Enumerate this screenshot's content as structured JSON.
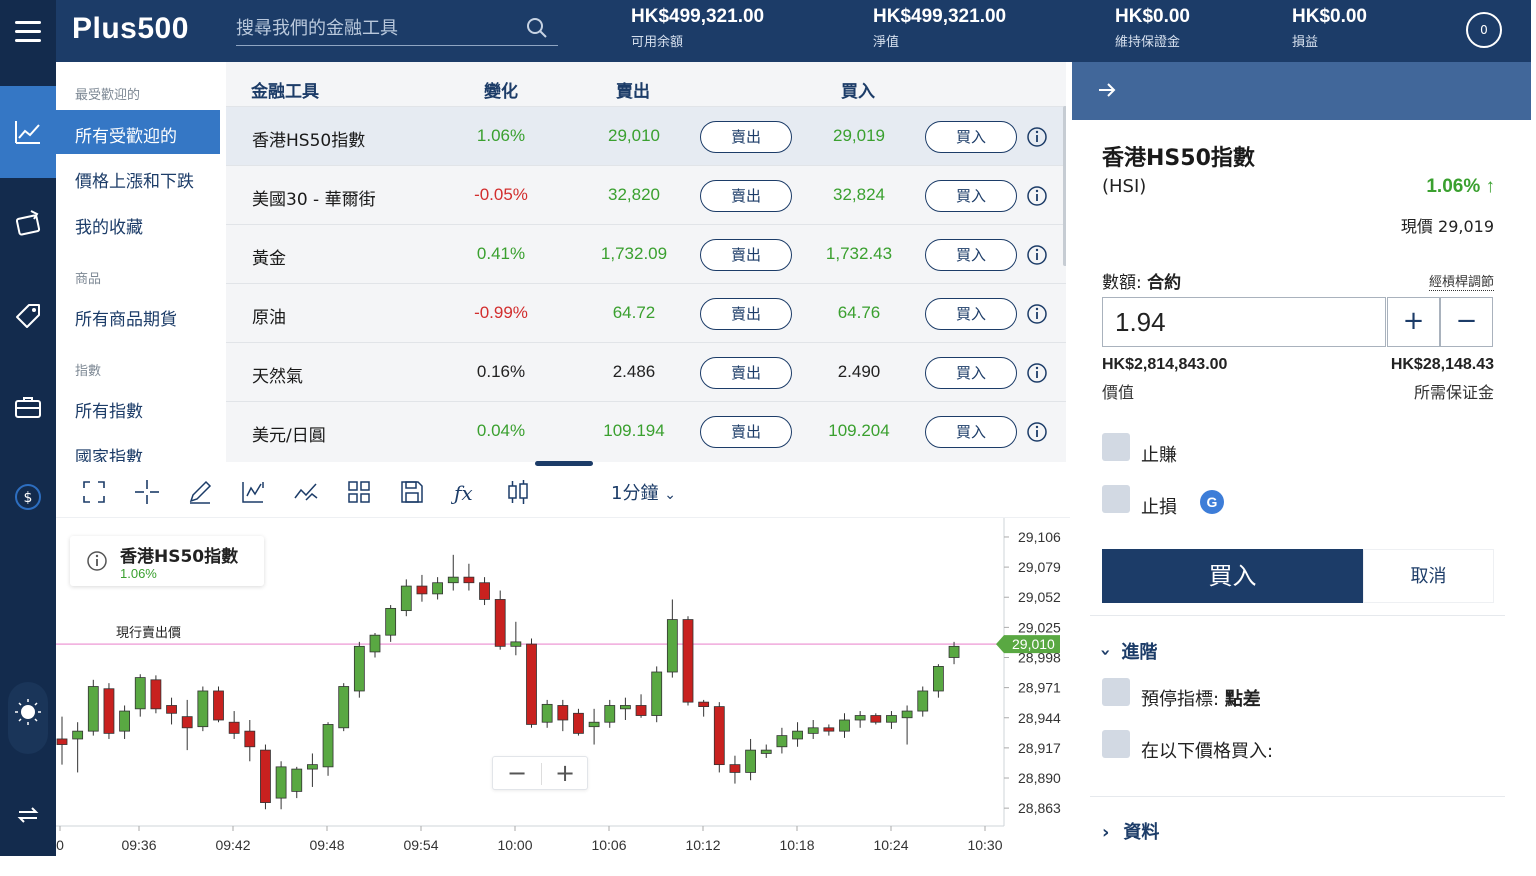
{
  "header": {
    "logo": "Plus500",
    "search_placeholder": "搜尋我們的金融工具",
    "stats": [
      {
        "value": "HK$499,321.00",
        "label": "可用余額"
      },
      {
        "value": "HK$499,321.00",
        "label": "淨值"
      },
      {
        "value": "HK$0.00",
        "label": "維持保證金"
      },
      {
        "value": "HK$0.00",
        "label": "損益"
      }
    ],
    "notifications": "0"
  },
  "categories": {
    "sections": [
      {
        "title": "最受歡迎的",
        "items": [
          "所有受歡迎的",
          "價格上漲和下跌",
          "我的收藏"
        ]
      },
      {
        "title": "商品",
        "items": [
          "所有商品期貨"
        ]
      },
      {
        "title": "指數",
        "items": [
          "所有指數",
          "國家指數"
        ]
      }
    ],
    "active": "所有受歡迎的"
  },
  "table": {
    "headers": {
      "instrument": "金融工具",
      "change": "變化",
      "sell": "賣出",
      "buy": "買入"
    },
    "sell_btn": "賣出",
    "buy_btn": "買入",
    "rows": [
      {
        "name": "香港HS50指數",
        "change": "1.06%",
        "dir": "pos",
        "sell": "29,010",
        "buy": "29,019"
      },
      {
        "name": "美國30 - 華爾街",
        "change": "-0.05%",
        "dir": "neg",
        "sell": "32,820",
        "buy": "32,824"
      },
      {
        "name": "黃金",
        "change": "0.41%",
        "dir": "pos",
        "sell": "1,732.09",
        "buy": "1,732.43"
      },
      {
        "name": "原油",
        "change": "-0.99%",
        "dir": "neg",
        "sell": "64.72",
        "buy": "64.76"
      },
      {
        "name": "天然氣",
        "change": "0.16%",
        "dir": "neu",
        "sell": "2.486",
        "buy": "2.490"
      },
      {
        "name": "美元/日圓",
        "change": "0.04%",
        "dir": "pos",
        "sell": "109.194",
        "buy": "109.204"
      }
    ]
  },
  "chart_toolbar": {
    "icons": [
      "fullscreen-icon",
      "crosshair-icon",
      "draw-icon",
      "chart-type-icon",
      "indicator-icon",
      "layout-icon",
      "save-icon",
      "function-icon",
      "candle-icon"
    ],
    "timeframe": "1分鐘"
  },
  "chart_legend": {
    "title": "香港HS50指數",
    "change": "1.06%"
  },
  "current_sell_label": "現行賣出價",
  "chart_data": {
    "type": "candlestick",
    "y_ticks": [
      "29,106",
      "29,079",
      "29,052",
      "29,025",
      "28,998",
      "28,971",
      "28,944",
      "28,917",
      "28,890",
      "28,863"
    ],
    "x_ticks": [
      "0",
      "09:36",
      "09:42",
      "09:48",
      "09:54",
      "10:00",
      "10:06",
      "10:12",
      "10:18",
      "10:24",
      "10:30"
    ],
    "current_price": 29010,
    "current_price_label": "29,010",
    "ylim": [
      28847,
      29123
    ],
    "candles": [
      [
        28925,
        28945,
        28902,
        28920
      ],
      [
        28925,
        28940,
        28895,
        28932
      ],
      [
        28932,
        28978,
        28928,
        28972
      ],
      [
        28970,
        28975,
        28925,
        28930
      ],
      [
        28932,
        28955,
        28925,
        28950
      ],
      [
        28952,
        28983,
        28945,
        28980
      ],
      [
        28978,
        28982,
        28948,
        28952
      ],
      [
        28955,
        28962,
        28938,
        28948
      ],
      [
        28945,
        28960,
        28915,
        28935
      ],
      [
        28936,
        28972,
        28932,
        28968
      ],
      [
        28968,
        28972,
        28940,
        28942
      ],
      [
        28940,
        28950,
        28925,
        28930
      ],
      [
        28932,
        28942,
        28905,
        28918
      ],
      [
        28915,
        28920,
        28862,
        28868
      ],
      [
        28872,
        28905,
        28862,
        28900
      ],
      [
        28878,
        28900,
        28872,
        28898
      ],
      [
        28898,
        28912,
        28882,
        28902
      ],
      [
        28900,
        28940,
        28892,
        28938
      ],
      [
        28935,
        28975,
        28932,
        28972
      ],
      [
        28968,
        29012,
        28962,
        29008
      ],
      [
        29003,
        29020,
        28998,
        29018
      ],
      [
        29018,
        29045,
        29012,
        29042
      ],
      [
        29040,
        29068,
        29035,
        29062
      ],
      [
        29062,
        29072,
        29048,
        29055
      ],
      [
        29055,
        29070,
        29050,
        29065
      ],
      [
        29065,
        29090,
        29058,
        29070
      ],
      [
        29070,
        29082,
        29058,
        29065
      ],
      [
        29065,
        29070,
        29045,
        29050
      ],
      [
        29050,
        29058,
        29005,
        29008
      ],
      [
        29008,
        29030,
        29000,
        29012
      ],
      [
        29010,
        29015,
        28935,
        28938
      ],
      [
        28940,
        28960,
        28935,
        28956
      ],
      [
        28955,
        28960,
        28932,
        28942
      ],
      [
        28948,
        28952,
        28928,
        28930
      ],
      [
        28936,
        28952,
        28920,
        28940
      ],
      [
        28940,
        28960,
        28935,
        28955
      ],
      [
        28952,
        28962,
        28942,
        28955
      ],
      [
        28955,
        28965,
        28944,
        28946
      ],
      [
        28946,
        28990,
        28940,
        28985
      ],
      [
        28985,
        29050,
        28980,
        29032
      ],
      [
        29032,
        29035,
        28955,
        28958
      ],
      [
        28958,
        28960,
        28945,
        28954
      ],
      [
        28954,
        28958,
        28895,
        28902
      ],
      [
        28902,
        28910,
        28885,
        28895
      ],
      [
        28895,
        28925,
        28888,
        28915
      ],
      [
        28912,
        28920,
        28908,
        28915
      ],
      [
        28918,
        28935,
        28912,
        28928
      ],
      [
        28925,
        28940,
        28918,
        28932
      ],
      [
        28930,
        28942,
        28925,
        28935
      ],
      [
        28935,
        28938,
        28928,
        28932
      ],
      [
        28932,
        28948,
        28926,
        28942
      ],
      [
        28942,
        28950,
        28935,
        28946
      ],
      [
        28946,
        28948,
        28938,
        28940
      ],
      [
        28940,
        28950,
        28934,
        28946
      ],
      [
        28944,
        28955,
        28920,
        28950
      ],
      [
        28950,
        28972,
        28945,
        28968
      ],
      [
        28968,
        28992,
        28962,
        28990
      ],
      [
        28998,
        29012,
        28992,
        29008
      ]
    ]
  },
  "order_panel": {
    "title": "香港HS50指數",
    "symbol": "(HSI)",
    "change": "1.06% ↑",
    "price": "現價 29,019",
    "amount_label": "數額:",
    "amount_unit": "合約",
    "leverage": "經槓桿調節",
    "quantity": "1.94",
    "plus": "+",
    "minus": "−",
    "value": "HK$2,814,843.00",
    "value_label": "價值",
    "margin": "HK$28,148.43",
    "margin_label": "所需保证金",
    "take_profit": "止賺",
    "stop_loss": "止損",
    "g_badge": "G",
    "buy": "買入",
    "cancel": "取消",
    "advanced": "進階",
    "stop_indicator_label": "預停指標:",
    "stop_indicator_value": "點差",
    "limit_buy": "在以下價格買入:",
    "info": "資料"
  }
}
